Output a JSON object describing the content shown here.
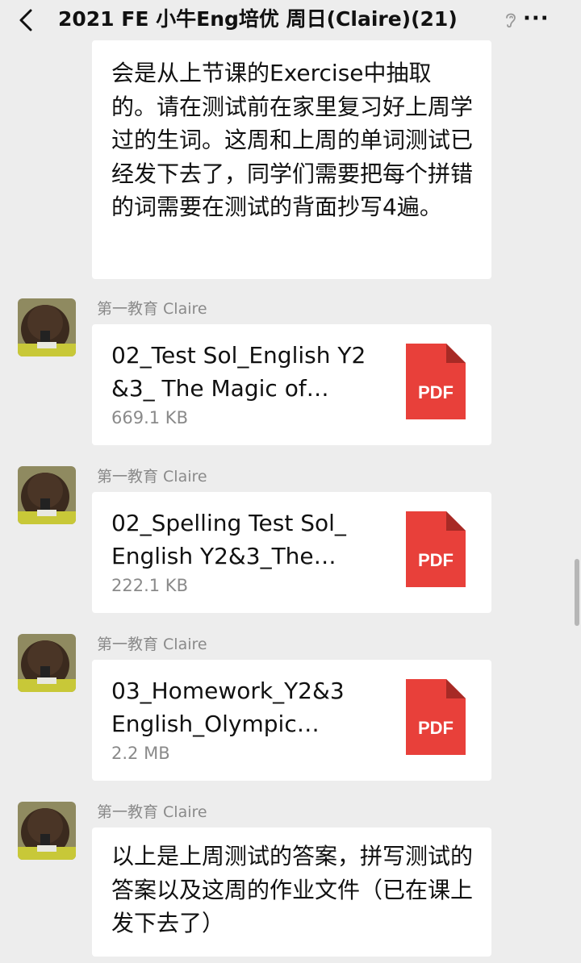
{
  "header": {
    "title": "2021 FE 小牛Eng培优 周日(Claire)(21)",
    "more": "···"
  },
  "messages": {
    "first_text": "会是从上节课的Exercise中抽取的。请在测试前在家里复习好上周学过的生词。这周和上周的单词测试已经发下去了，同学们需要把每个拼错的词需要在测试的背面抄写4遍。",
    "sender": "第一教育 Claire",
    "files": [
      {
        "name": "02_Test Sol_English Y2 &3_ The Magic of…",
        "size": "669.1 KB",
        "icon_label": "PDF"
      },
      {
        "name": "02_Spelling Test Sol_ English Y2&3_The…",
        "size": "222.1 KB",
        "icon_label": "PDF"
      },
      {
        "name": "03_Homework_Y2&3 English_Olympic…",
        "size": "2.2 MB",
        "icon_label": "PDF"
      }
    ],
    "last_text": "以上是上周测试的答案，拼写测试的答案以及这周的作业文件（已在课上发下去了）"
  },
  "colors": {
    "background": "#ededed",
    "bubble": "#ffffff",
    "pdf_red": "#e8403a",
    "muted_text": "#8a8a8a"
  },
  "icons": [
    "back-arrow-icon",
    "ear-icon",
    "more-icon",
    "pdf-icon",
    "avatar"
  ]
}
